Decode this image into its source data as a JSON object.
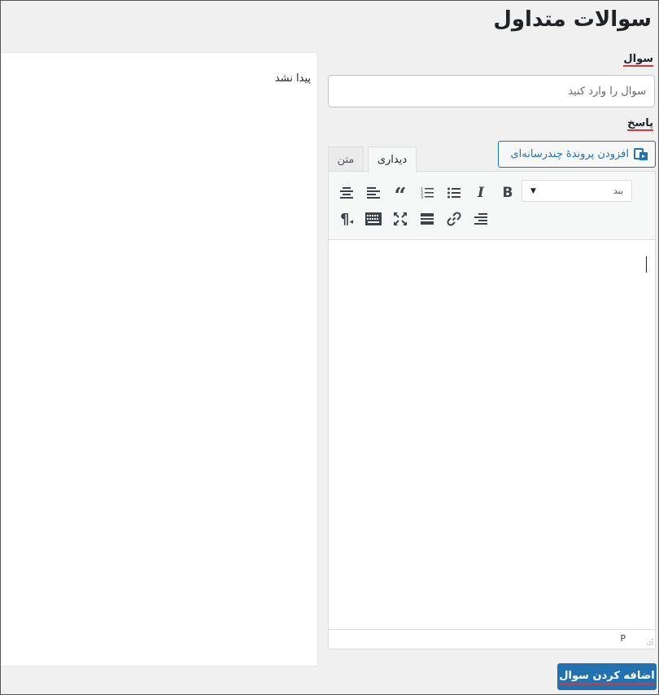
{
  "page": {
    "title": "سوالات متداول"
  },
  "list_panel": {
    "empty_text": "پیدا نشد"
  },
  "form": {
    "question_label": "سوال",
    "question_placeholder": "سوال را وارد کنید",
    "question_value": "",
    "answer_label": "پاسخ",
    "add_media_label": "افزودن پروندهٔ چندرسانه‌ای",
    "submit_label": "اضافه کردن سوال"
  },
  "editor": {
    "tabs": [
      {
        "label": "دیداری",
        "active": true
      },
      {
        "label": "متن",
        "active": false
      }
    ],
    "format_select": {
      "selected": "بند"
    },
    "toolbar_row1": [
      "bold-icon",
      "italic-icon",
      "bullet-list-icon",
      "numbered-list-icon",
      "blockquote-icon",
      "align-left-icon",
      "align-center-icon"
    ],
    "toolbar_row2": [
      "align-right-icon",
      "link-icon",
      "more-tag-icon",
      "fullscreen-icon",
      "toolbar-toggle-icon",
      "rtl-paragraph-icon"
    ],
    "status_path": "P"
  },
  "colors": {
    "accent": "#2271b1",
    "underline": "#d63638",
    "background": "#f0f0f1"
  }
}
